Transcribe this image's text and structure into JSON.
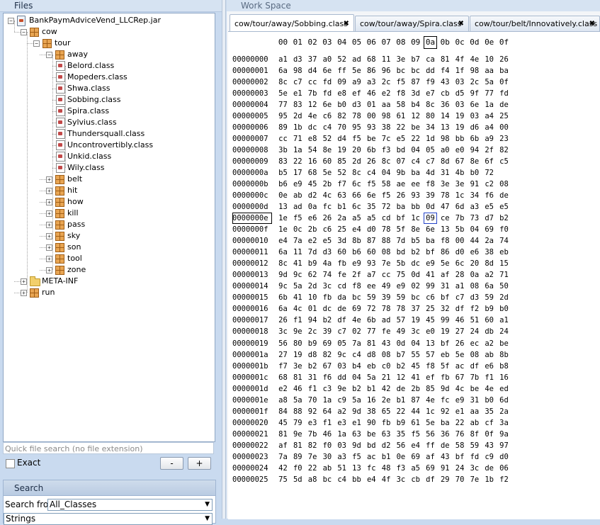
{
  "files_panel": {
    "title": "Files",
    "tree": [
      {
        "label": "BankPaymAdviceVend_LLCRep.jar",
        "icon": "jar-icon",
        "level": 0,
        "expanded": true
      },
      {
        "label": "cow",
        "icon": "package-icon",
        "level": 1,
        "expanded": true
      },
      {
        "label": "tour",
        "icon": "package-icon",
        "level": 2,
        "expanded": true
      },
      {
        "label": "away",
        "icon": "package-icon",
        "level": 3,
        "expanded": true
      },
      {
        "label": "Belord.class",
        "icon": "class-file-icon",
        "level": 4
      },
      {
        "label": "Mopeders.class",
        "icon": "class-file-icon",
        "level": 4
      },
      {
        "label": "Shwa.class",
        "icon": "class-file-icon",
        "level": 4
      },
      {
        "label": "Sobbing.class",
        "icon": "class-file-icon",
        "level": 4
      },
      {
        "label": "Spira.class",
        "icon": "class-file-icon",
        "level": 4
      },
      {
        "label": "Sylvius.class",
        "icon": "class-file-icon",
        "level": 4
      },
      {
        "label": "Thundersquall.class",
        "icon": "class-file-icon",
        "level": 4
      },
      {
        "label": "Uncontrovertibly.class",
        "icon": "class-file-icon",
        "level": 4
      },
      {
        "label": "Unkid.class",
        "icon": "class-file-icon",
        "level": 4
      },
      {
        "label": "Wily.class",
        "icon": "class-file-icon",
        "level": 4
      },
      {
        "label": "belt",
        "icon": "package-icon",
        "level": 3,
        "expanded": false
      },
      {
        "label": "hit",
        "icon": "package-icon",
        "level": 3,
        "expanded": false
      },
      {
        "label": "how",
        "icon": "package-icon",
        "level": 3,
        "expanded": false
      },
      {
        "label": "kill",
        "icon": "package-icon",
        "level": 3,
        "expanded": false
      },
      {
        "label": "pass",
        "icon": "package-icon",
        "level": 3,
        "expanded": false
      },
      {
        "label": "sky",
        "icon": "package-icon",
        "level": 3,
        "expanded": false
      },
      {
        "label": "son",
        "icon": "package-icon",
        "level": 3,
        "expanded": false
      },
      {
        "label": "tool",
        "icon": "package-icon",
        "level": 3,
        "expanded": false
      },
      {
        "label": "zone",
        "icon": "package-icon",
        "level": 3,
        "expanded": false
      },
      {
        "label": "META-INF",
        "icon": "folder-icon",
        "level": 1,
        "expanded": false
      },
      {
        "label": "run",
        "icon": "package-icon",
        "level": 1,
        "expanded": false
      }
    ],
    "quick_search_placeholder": "Quick file search (no file extension)",
    "exact_label": "Exact",
    "minus_label": "-",
    "plus_label": "+"
  },
  "search_panel": {
    "title": "Search",
    "search_from_label": "Search from",
    "search_from_value": "All_Classes",
    "search_type_value": "Strings"
  },
  "workspace": {
    "title": "Work Space",
    "tabs": [
      {
        "label": "cow/tour/away/Sobbing.class",
        "active": true
      },
      {
        "label": "cow/tour/away/Spira.class",
        "active": false
      },
      {
        "label": "cow/tour/belt/Innovatively.class",
        "active": false
      }
    ],
    "close_glyph": "✖"
  },
  "hex_view": {
    "column_headers": [
      "00",
      "01",
      "02",
      "03",
      "04",
      "05",
      "06",
      "07",
      "08",
      "09",
      "0a",
      "0b",
      "0c",
      "0d",
      "0e",
      "0f"
    ],
    "selected_column": "0a",
    "selected_offset": "0000000e",
    "selected_cell": {
      "row": "0000000e",
      "column": "0a",
      "value": "09"
    },
    "rows": [
      {
        "offset": "00000000",
        "bytes": "a1 d3 37 a0 52 ad 68 11 3e b7 ca 81 4f 4e 10 26"
      },
      {
        "offset": "00000001",
        "bytes": "6a 98 d4 6e ff 5e 86 96 bc bc dd f4 1f 98 aa ba"
      },
      {
        "offset": "00000002",
        "bytes": "8c c7 cc fd 09 a9 a3 2c f5 87 f9 43 03 2c 5a 0f"
      },
      {
        "offset": "00000003",
        "bytes": "5e e1 7b fd e8 ef 46 e2 f8 3d e7 cb d5 9f 77 fd"
      },
      {
        "offset": "00000004",
        "bytes": "77 83 12 6e b0 d3 01 aa 58 b4 8c 36 03 6e 1a de"
      },
      {
        "offset": "00000005",
        "bytes": "95 2d 4e c6 82 78 00 98 61 12 80 14 19 03 a4 25"
      },
      {
        "offset": "00000006",
        "bytes": "89 1b dc c4 70 95 93 38 22 be 34 13 19 d6 a4 00"
      },
      {
        "offset": "00000007",
        "bytes": "cc 71 e8 52 d4 f5 be 7c e5 22 1d 98 bb 6b a9 23"
      },
      {
        "offset": "00000008",
        "bytes": "3b 1a 54 8e 19 20 6b f3 bd 04 05 a0 e0 94 2f 82"
      },
      {
        "offset": "00000009",
        "bytes": "83 22 16 60 85 2d 26 8c 07 c4 c7 8d 67 8e 6f c5"
      },
      {
        "offset": "0000000a",
        "bytes": "b5 17 68 5e 52 8c c4 04 9b ba 4d 31 4b b0 72"
      },
      {
        "offset": "0000000b",
        "bytes": "b6 e9 45 2b f7 6c f5 58 ae ee f8 3e 3e 91 c2 08"
      },
      {
        "offset": "0000000c",
        "bytes": "0e ab d2 4c 63 66 6e f5 26 93 39 78 1c 34 f6 de"
      },
      {
        "offset": "0000000d",
        "bytes": "13 ad 0a fc b1 6c 35 72 ba bb 0d 47 6d a3 e5 e5"
      },
      {
        "offset": "0000000e",
        "bytes": "1e f5 e6 26 2a a5 a5 cd bf 1c 09 ce 7b 73 d7 b2"
      },
      {
        "offset": "0000000f",
        "bytes": "1e 0c 2b c6 25 e4 d0 78 5f 8e 6e 13 5b 04 69 f0"
      },
      {
        "offset": "00000010",
        "bytes": "e4 7a e2 e5 3d 8b 87 88 7d b5 ba f8 00 44 2a 74"
      },
      {
        "offset": "00000011",
        "bytes": "6a 11 7d d3 60 b6 60 08 bd b2 bf 86 d0 e6 38 eb"
      },
      {
        "offset": "00000012",
        "bytes": "8c 41 b9 4a fb e9 93 7e 5b dc e9 5e 6c 20 8d 15"
      },
      {
        "offset": "00000013",
        "bytes": "9d 9c 62 74 fe 2f a7 cc 75 0d 41 af 28 0a a2 71"
      },
      {
        "offset": "00000014",
        "bytes": "9c 5a 2d 3c cd f8 ee 49 e9 02 99 31 a1 08 6a 50"
      },
      {
        "offset": "00000015",
        "bytes": "6b 41 10 fb da bc 59 39 59 bc c6 bf c7 d3 59 2d"
      },
      {
        "offset": "00000016",
        "bytes": "6a 4c 01 dc de 69 72 78 78 37 25 32 df f2 b9 b0"
      },
      {
        "offset": "00000017",
        "bytes": "26 f1 94 b2 df 4e 6b ad 57 19 45 99 46 51 60 a1"
      },
      {
        "offset": "00000018",
        "bytes": "3c 9e 2c 39 c7 02 77 fe 49 3c e0 19 27 24 db 24"
      },
      {
        "offset": "00000019",
        "bytes": "56 80 b9 69 05 7a 81 43 0d 04 13 bf 26 ec a2 be"
      },
      {
        "offset": "0000001a",
        "bytes": "27 19 d8 82 9c c4 d8 08 b7 55 57 eb 5e 08 ab 8b"
      },
      {
        "offset": "0000001b",
        "bytes": "f7 3e b2 67 03 b4 eb c0 b2 45 f8 5f ac df e6 b8"
      },
      {
        "offset": "0000001c",
        "bytes": "68 81 31 f6 dd 04 5a 21 12 41 ef fb 67 7b f1 16"
      },
      {
        "offset": "0000001d",
        "bytes": "e2 46 f1 c3 9e b2 b1 42 de 2b 85 9d 4c be 4e ed"
      },
      {
        "offset": "0000001e",
        "bytes": "a8 5a 70 1a c9 5a 16 2e b1 87 4e fc e9 31 b0 6d"
      },
      {
        "offset": "0000001f",
        "bytes": "84 88 92 64 a2 9d 38 65 22 44 1c 92 e1 aa 35 2a"
      },
      {
        "offset": "00000020",
        "bytes": "45 79 e3 f1 e3 e1 90 fb b9 61 5e ba 22 ab cf 3a"
      },
      {
        "offset": "00000021",
        "bytes": "81 9e 7b 46 1a 63 be 63 35 f5 56 36 76 8f 0f 9a"
      },
      {
        "offset": "00000022",
        "bytes": "af 81 82 f0 03 9d bd d2 56 e4 ff de 58 59 43 97"
      },
      {
        "offset": "00000023",
        "bytes": "7a 89 7e 30 a3 f5 ac b1 0e 69 af 43 bf fd c9 d0"
      },
      {
        "offset": "00000024",
        "bytes": "42 f0 22 ab 51 13 fc 48 f3 a5 69 91 24 3c de 06"
      },
      {
        "offset": "00000025",
        "bytes": "75 5d a8 bc c4 bb e4 4f 3c cb df 29 70 7e 1b f2"
      }
    ]
  }
}
